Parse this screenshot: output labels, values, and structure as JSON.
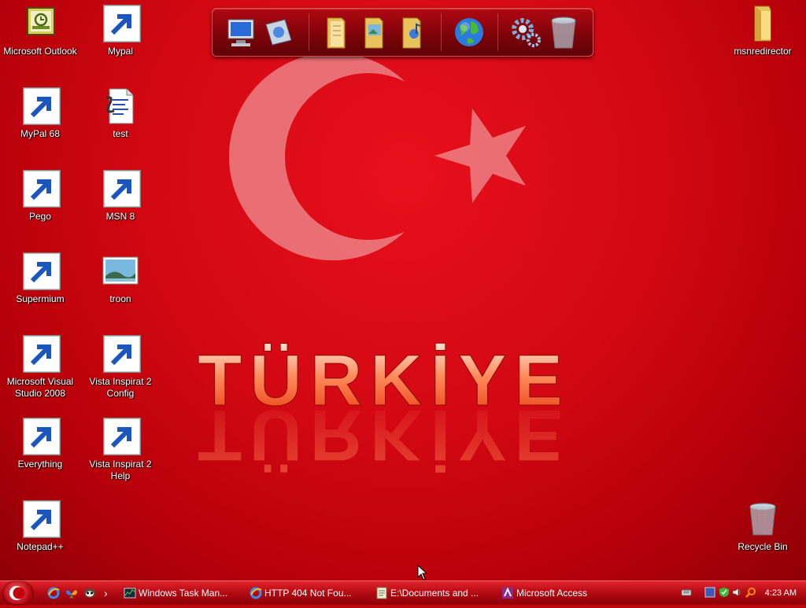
{
  "wallpaper": {
    "text": "TÜRKİYE"
  },
  "desktop_icons_left": [
    {
      "label": "Microsoft Outlook",
      "icon": "outlook-icon"
    },
    {
      "label": "Mypal",
      "icon": "mypal-icon"
    },
    {
      "label": "MyPal 68",
      "icon": "mypal-icon"
    },
    {
      "label": "test",
      "icon": "script-file-icon"
    },
    {
      "label": "Pego",
      "icon": "pego-icon"
    },
    {
      "label": "MSN 8",
      "icon": "msn-butterfly-icon"
    },
    {
      "label": "Supermium",
      "icon": "supermium-icon"
    },
    {
      "label": "troon",
      "icon": "image-file-icon"
    },
    {
      "label": "Microsoft Visual Studio 2008",
      "icon": "visual-studio-icon"
    },
    {
      "label": "Vista Inspirat 2 Config",
      "icon": "windows-logo-icon"
    },
    {
      "label": "Everything",
      "icon": "everything-search-icon"
    },
    {
      "label": "Vista Inspirat 2 Help",
      "icon": "help-icon"
    },
    {
      "label": "Notepad++",
      "icon": "notepadpp-icon"
    }
  ],
  "desktop_icons_right": [
    {
      "label": "msnredirector",
      "icon": "folder-icon"
    },
    {
      "label": "Recycle Bin",
      "icon": "recycle-bin-icon"
    }
  ],
  "dock": {
    "items": [
      "computer-icon",
      "control-panel-icon",
      "documents-folder-icon",
      "pictures-folder-icon",
      "music-folder-icon",
      "internet-globe-icon",
      "settings-gears-icon",
      "recycle-bin-icon"
    ]
  },
  "taskbar": {
    "quick_launch": [
      "internet-explorer-icon",
      "msn-butterfly-icon",
      "mypal-icon"
    ],
    "overflow": "›",
    "buttons": [
      {
        "label": "Windows Task Man...",
        "icon": "task-manager-icon"
      },
      {
        "label": "HTTP 404 Not Fou...",
        "icon": "internet-explorer-icon"
      },
      {
        "label": "E:\\Documents and ...",
        "icon": "notepad-icon"
      },
      {
        "label": "Microsoft Access",
        "icon": "access-icon"
      }
    ],
    "tray_icons": [
      "keyboard-icon",
      "network-icon",
      "shield-icon",
      "volume-icon",
      "search-icon"
    ],
    "clock": "4:23 AM"
  },
  "colors": {
    "accent": "#c4000c",
    "taskbar": "#b20912"
  }
}
